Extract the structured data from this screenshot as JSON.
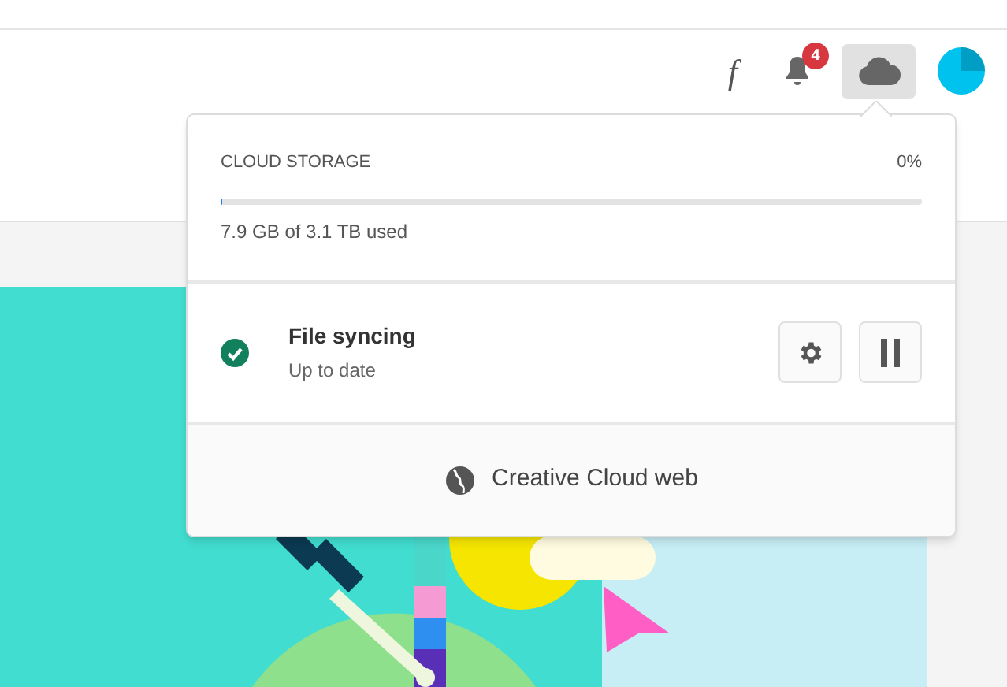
{
  "header": {
    "font_icon": "f",
    "notification_count": "4"
  },
  "cloud_popover": {
    "storage": {
      "title": "CLOUD STORAGE",
      "percent": "0%",
      "level": 0.003,
      "usage": "7.9 GB of 3.1 TB used"
    },
    "sync": {
      "title": "File syncing",
      "status": "Up to date",
      "ok": true
    },
    "web_link": "Creative Cloud web"
  }
}
